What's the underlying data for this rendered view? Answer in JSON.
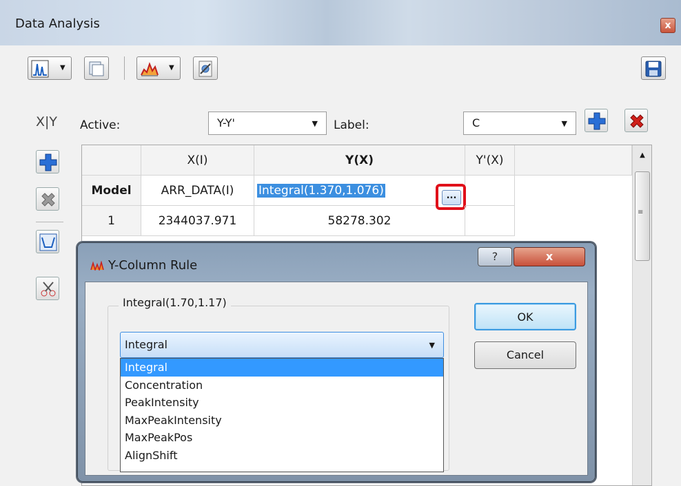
{
  "window": {
    "title": "Data Analysis",
    "close_glyph": "x"
  },
  "toolbar": {
    "icons": [
      "spectrum-icon",
      "copy-icon",
      "chart-icon",
      "settings-icon",
      "save-icon"
    ]
  },
  "active_row": {
    "icon_text": "X|Y",
    "active_label": "Active:",
    "active_value": "Y-Y'",
    "label_label": "Label:",
    "label_value": "C"
  },
  "grid": {
    "columns": [
      "",
      "X(I)",
      "Y(X)",
      "Y'(X)"
    ],
    "rows": [
      {
        "head": "Model",
        "x": "ARR_DATA(I)",
        "y": "Integral(1.370,1.076)",
        "button": "...",
        "yp": ""
      },
      {
        "head": "1",
        "x": "2344037.971",
        "y": "58278.302",
        "yp": ""
      }
    ],
    "scroll_grip": "≡"
  },
  "dialog": {
    "title": "Y-Column Rule",
    "help_glyph": "?",
    "close_glyph": "x",
    "group_label": "Integral(1.70,1.17)",
    "selected": "Integral",
    "options": [
      "Integral",
      "Concentration",
      "PeakIntensity",
      "MaxPeakIntensity",
      "MaxPeakPos",
      "AlignShift"
    ],
    "ok": "OK",
    "cancel": "Cancel"
  },
  "colors": {
    "highlight": "#3399ff",
    "red_outline": "#e0101a",
    "add": "#2a6fd6",
    "delete": "#d0201a"
  }
}
